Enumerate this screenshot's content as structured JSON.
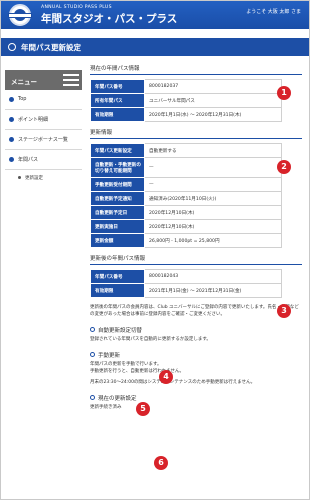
{
  "header": {
    "brand_small": "ANNUAL STUDIO PASS PLUS",
    "brand_main": "年間スタジオ・パス・プラス",
    "greeting": "ようこそ 大阪 太郎 さま"
  },
  "page_title": "年間パス更新設定",
  "sidebar": {
    "menu_label": "メニュー",
    "items": [
      "Top",
      "ポイント明細",
      "ステージボーナス一覧",
      "年間パス"
    ],
    "sub_items": [
      "更新設定"
    ]
  },
  "current_pass": {
    "heading": "現在の年間パス情報",
    "rows": [
      {
        "key": "年間パス番号",
        "value": "8000182037"
      },
      {
        "key": "所有年間パス",
        "value": "ユニバーサル年間パス"
      },
      {
        "key": "有効期限",
        "value": "2020年1月1日(水) 〜 2020年12月31日(木)"
      }
    ]
  },
  "renewal_info": {
    "heading": "更新情報",
    "rows": [
      {
        "key": "年間パス更新設定",
        "value": "自動更新する"
      },
      {
        "key": "自動更新・手動更新の切り替え可能期間",
        "value": "—"
      },
      {
        "key": "手動更新受付期間",
        "value": "—"
      },
      {
        "key": "自動更新予定通知",
        "value": "通知済み(2020年11月10日(火))"
      },
      {
        "key": "自動更新予定日",
        "value": "2020年12月10日(木)"
      },
      {
        "key": "更新実施日",
        "value": "2020年12月10日(木)"
      },
      {
        "key": "更新金額",
        "value": "26,800円 - 1,000pt = 25,800円"
      }
    ]
  },
  "after_pass": {
    "heading": "更新後の年間パス情報",
    "rows": [
      {
        "key": "年間パス番号",
        "value": "8000182043"
      },
      {
        "key": "有効期限",
        "value": "2021年1月1日(金) 〜 2021年12月31日(金)"
      }
    ],
    "note": "更新後の年間パスの会員内容は、Club ユニバーサルにご登録の内容で更新いたします。氏名・住所などの変更があった場合は事前に登録内容をご確認・ご変更ください。"
  },
  "auto_switch": {
    "heading": "自動更新設定切替",
    "text": "登録されている年間パスを自動的に更新するか設定します。"
  },
  "manual_renewal": {
    "heading": "手動更新",
    "text1": "年間パスの更新を手動で行います。",
    "text2": "手動更新を行うと、自動更新は行われません。",
    "text3": "月末の23:30〜24:00の間はシステムメンテナンスのため手動更新は行えません。"
  },
  "current_setting": {
    "heading": "現在の更新設定",
    "text": "更新手続き済み"
  },
  "badges": [
    "1",
    "2",
    "3",
    "4",
    "5",
    "6"
  ],
  "colors": {
    "brand_blue": "#1d4fa6",
    "badge_red": "#d8232a",
    "menu_gray": "#6b6b6b"
  }
}
